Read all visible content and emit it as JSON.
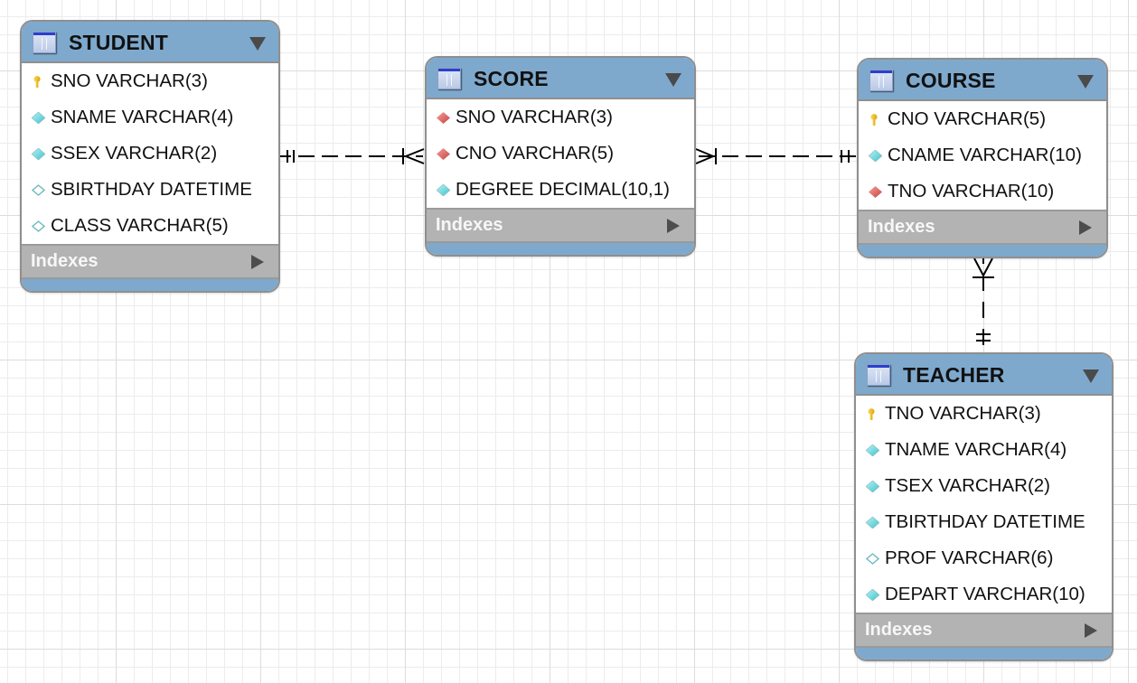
{
  "diagram": {
    "type": "EER diagram",
    "colors": {
      "header": "#7ea9cd",
      "indexes_bar": "#b3b3b3",
      "primary_key": "#f2c419",
      "foreign_key": "#e0635e",
      "not_null_column": "#5fd6dc",
      "nullable_column": "#ffffff"
    },
    "entities": {
      "student": {
        "title": "STUDENT",
        "indexes_label": "Indexes",
        "columns": [
          {
            "name": "SNO VARCHAR(3)",
            "icon": "primary-key"
          },
          {
            "name": "SNAME VARCHAR(4)",
            "icon": "not-null-column"
          },
          {
            "name": "SSEX VARCHAR(2)",
            "icon": "not-null-column"
          },
          {
            "name": "SBIRTHDAY DATETIME",
            "icon": "nullable-column"
          },
          {
            "name": "CLASS VARCHAR(5)",
            "icon": "nullable-column"
          }
        ]
      },
      "score": {
        "title": "SCORE",
        "indexes_label": "Indexes",
        "columns": [
          {
            "name": "SNO VARCHAR(3)",
            "icon": "foreign-key"
          },
          {
            "name": "CNO VARCHAR(5)",
            "icon": "foreign-key"
          },
          {
            "name": "DEGREE DECIMAL(10,1)",
            "icon": "not-null-column"
          }
        ]
      },
      "course": {
        "title": "COURSE",
        "indexes_label": "Indexes",
        "columns": [
          {
            "name": "CNO VARCHAR(5)",
            "icon": "primary-key"
          },
          {
            "name": "CNAME VARCHAR(10)",
            "icon": "not-null-column"
          },
          {
            "name": "TNO VARCHAR(10)",
            "icon": "foreign-key"
          }
        ]
      },
      "teacher": {
        "title": "TEACHER",
        "indexes_label": "Indexes",
        "columns": [
          {
            "name": "TNO VARCHAR(3)",
            "icon": "primary-key"
          },
          {
            "name": "TNAME VARCHAR(4)",
            "icon": "not-null-column"
          },
          {
            "name": "TSEX VARCHAR(2)",
            "icon": "not-null-column"
          },
          {
            "name": "TBIRTHDAY DATETIME",
            "icon": "not-null-column"
          },
          {
            "name": "PROF VARCHAR(6)",
            "icon": "nullable-column"
          },
          {
            "name": "DEPART VARCHAR(10)",
            "icon": "not-null-column"
          }
        ]
      }
    },
    "relationships": [
      {
        "from": "STUDENT",
        "to": "SCORE",
        "from_cardinality": "one-and-only-one",
        "to_cardinality": "one-or-many",
        "style": "dashed"
      },
      {
        "from": "COURSE",
        "to": "SCORE",
        "from_cardinality": "one-and-only-one",
        "to_cardinality": "one-or-many",
        "style": "dashed"
      },
      {
        "from": "TEACHER",
        "to": "COURSE",
        "from_cardinality": "one-and-only-one",
        "to_cardinality": "one-or-many",
        "style": "dashed"
      }
    ]
  }
}
